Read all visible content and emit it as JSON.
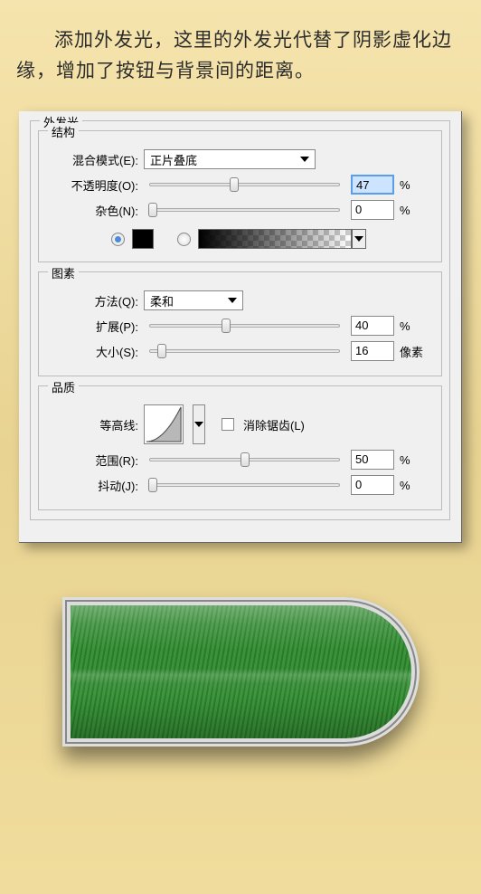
{
  "description": "添加外发光，这里的外发光代替了阴影虚化边缘，增加了按钮与背景间的距离。",
  "panel_title": "外发光",
  "sections": {
    "structure": {
      "title": "结构",
      "blend_mode_label": "混合模式(E):",
      "blend_mode_value": "正片叠底",
      "opacity_label": "不透明度(O):",
      "opacity_value": "47",
      "opacity_unit": "%",
      "noise_label": "杂色(N):",
      "noise_value": "0",
      "noise_unit": "%",
      "color_solid": "#000000",
      "gradient_selected": false
    },
    "elements": {
      "title": "图素",
      "technique_label": "方法(Q):",
      "technique_value": "柔和",
      "spread_label": "扩展(P):",
      "spread_value": "40",
      "spread_unit": "%",
      "size_label": "大小(S):",
      "size_value": "16",
      "size_unit": "像素"
    },
    "quality": {
      "title": "品质",
      "contour_label": "等高线:",
      "antialiased_label": "消除锯齿(L)",
      "range_label": "范围(R):",
      "range_value": "50",
      "range_unit": "%",
      "jitter_label": "抖动(J):",
      "jitter_value": "0",
      "jitter_unit": "%"
    }
  }
}
